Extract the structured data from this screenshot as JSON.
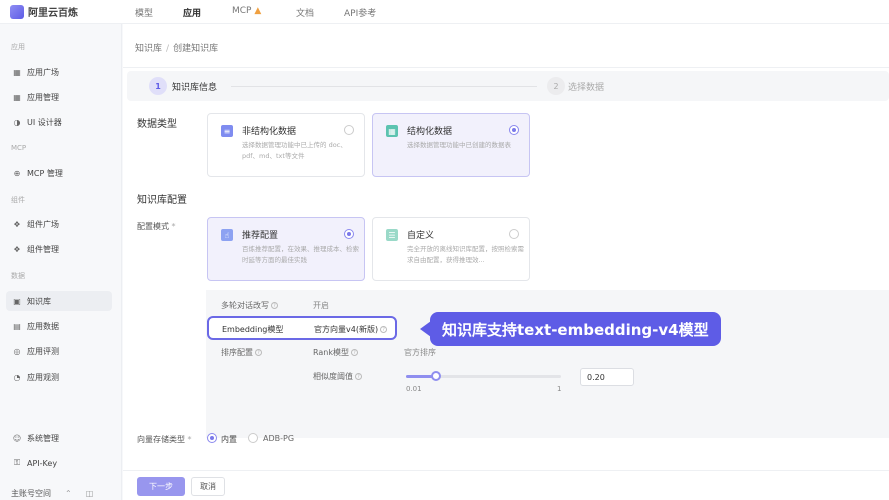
{
  "brand": {
    "name": "阿里云百炼"
  },
  "topnav": [
    {
      "label": "模型"
    },
    {
      "label": "应用"
    },
    {
      "label": "MCP"
    },
    {
      "label": "文档"
    },
    {
      "label": "API参考"
    }
  ],
  "sidebar": {
    "groups": {
      "apps": "应用",
      "mcp": "MCP",
      "components": "组件",
      "data": "数据"
    },
    "items": [
      {
        "label": "应用广场",
        "icon": "grid-icon"
      },
      {
        "label": "应用管理",
        "icon": "grid-icon"
      },
      {
        "label": "UI 设计器",
        "icon": "palette-icon"
      },
      {
        "label": "MCP 管理",
        "icon": "mcp-icon"
      },
      {
        "label": "组件广场",
        "icon": "puzzle-icon"
      },
      {
        "label": "组件管理",
        "icon": "puzzle-icon"
      },
      {
        "label": "知识库",
        "icon": "book-icon"
      },
      {
        "label": "应用数据",
        "icon": "chart-icon"
      },
      {
        "label": "应用评测",
        "icon": "target-icon"
      },
      {
        "label": "应用观测",
        "icon": "pie-icon"
      },
      {
        "label": "系统管理",
        "icon": "user-icon"
      },
      {
        "label": "API-Key",
        "icon": "key-icon"
      }
    ],
    "workspace": "主账号空间"
  },
  "breadcrumb": {
    "root": "知识库",
    "sep": "/",
    "current": "创建知识库"
  },
  "steps": [
    {
      "num": "1",
      "label": "知识库信息"
    },
    {
      "num": "2",
      "label": "选择数据"
    }
  ],
  "data_type": {
    "label": "数据类型",
    "options": [
      {
        "title": "非结构化数据",
        "desc": "选择数据管理功能中已上传的 doc、pdf、md、txt等文件"
      },
      {
        "title": "结构化数据",
        "desc": "选择数据管理功能中已创建的数据表"
      }
    ]
  },
  "kb_config": {
    "label": "知识库配置",
    "mode_label": "配置模式",
    "required_mark": "*",
    "modes": [
      {
        "title": "推荐配置",
        "desc": "百炼推荐配置，在效果、推理成本、检索时延等方面的最佳实践"
      },
      {
        "title": "自定义",
        "desc": "完全开放的离线知识库配置，按照检索需求自由配置，获得推理效..."
      }
    ]
  },
  "params": {
    "multi_turn_label": "多轮对话改写",
    "multi_turn_value": "开启",
    "embedding_label": "Embedding模型",
    "embedding_value": "官方向量v4(新版)",
    "rank_group_label": "排序配置",
    "rank_label": "Rank模型",
    "rank_value": "官方排序",
    "threshold_label": "相似度阈值",
    "slider_min": "0.01",
    "slider_max": "1",
    "threshold_value": "0.20"
  },
  "callout": {
    "text": "知识库支持text-embedding-v4模型"
  },
  "vector_store": {
    "label": "向量存储类型",
    "required_mark": "*",
    "options": [
      "内置",
      "ADB-PG"
    ]
  },
  "footer": {
    "next": "下一步",
    "cancel": "取消"
  },
  "colors": {
    "accent": "#5e5ce6",
    "accent_light": "#f2f1fc"
  }
}
